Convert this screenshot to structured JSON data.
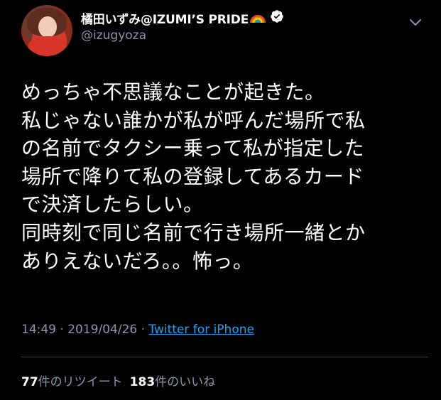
{
  "author": {
    "display_name": "橘田いずみ@IZUMI’S PRIDE",
    "handle": "@izugyoza",
    "emoji_icon": "rainbow-flag-icon",
    "verified_icon": "verified-badge-icon"
  },
  "tweet": {
    "lines": [
      "めっちゃ不思議なことが起きた。",
      "私じゃない誰かが私が呼んだ場所で私",
      "の名前でタクシー乗って私が指定した",
      "場所で降りて私の登録してあるカード",
      "で決済したらしい。",
      "同時刻で同じ名前で行き場所一緒とか",
      "ありえないだろ。。怖っ。"
    ]
  },
  "meta": {
    "time": "14:49",
    "separator1": " · ",
    "date": "2019/04/26",
    "separator2": " · ",
    "source": "Twitter for iPhone"
  },
  "stats": {
    "retweets_count": "77",
    "retweets_label": "件のリツイート",
    "likes_count": "183",
    "likes_label": "件のいいね"
  },
  "colors": {
    "background": "#000000",
    "text_primary": "#ffffff",
    "text_secondary": "#8899a6",
    "link": "#1da1f2",
    "divider": "#38444d"
  }
}
